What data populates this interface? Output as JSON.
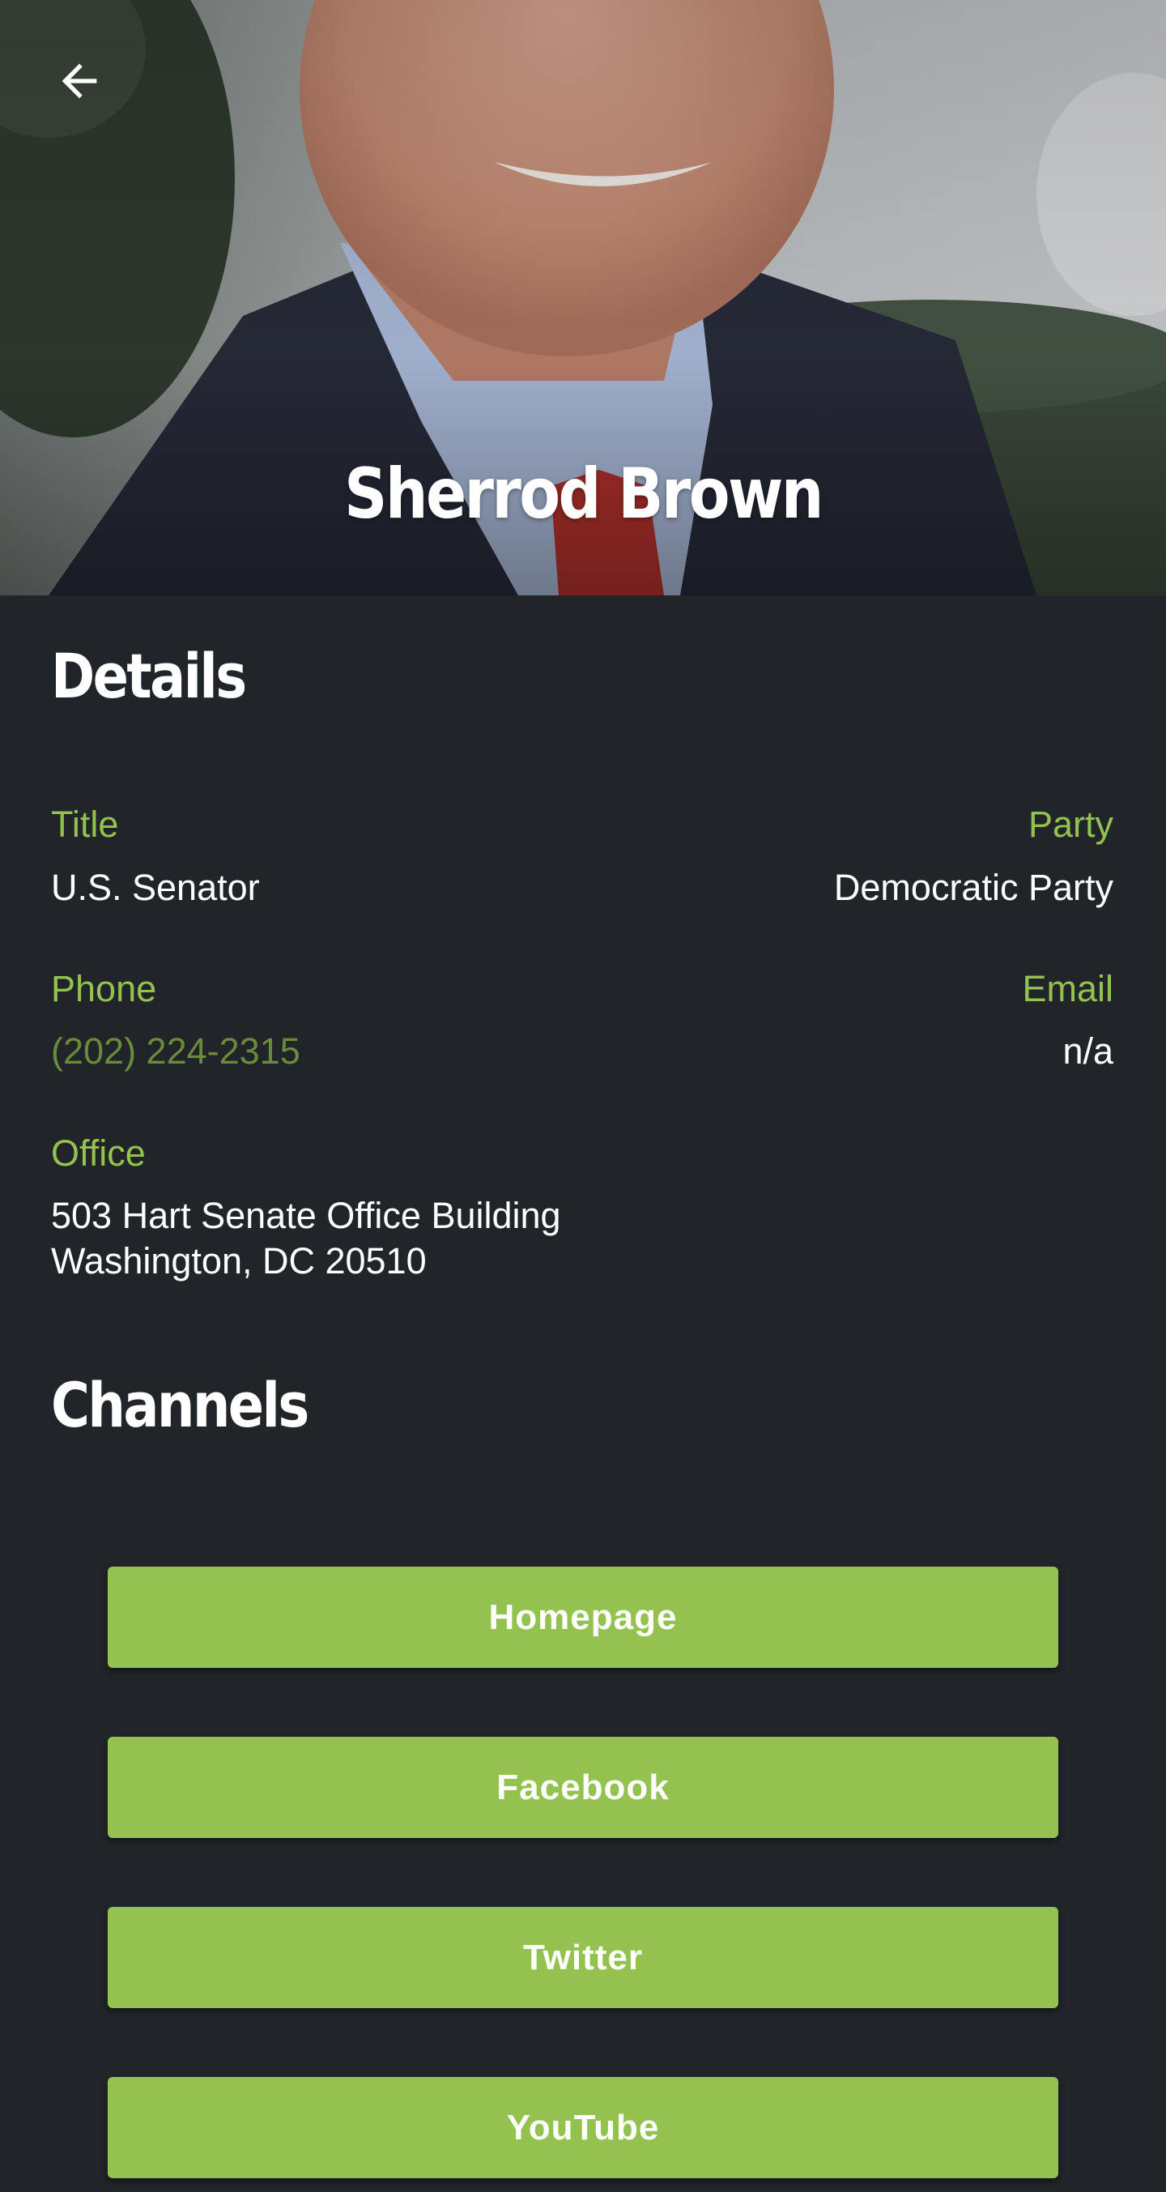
{
  "header": {
    "name": "Sherrod Brown",
    "back_icon": "arrow-left-icon"
  },
  "details": {
    "heading": "Details",
    "title_label": "Title",
    "title_value": "U.S. Senator",
    "party_label": "Party",
    "party_value": "Democratic Party",
    "phone_label": "Phone",
    "phone_value": "(202) 224-2315",
    "email_label": "Email",
    "email_value": "n/a",
    "office_label": "Office",
    "office_line1": "503 Hart Senate Office Building",
    "office_line2": "Washington, DC 20510"
  },
  "channels": {
    "heading": "Channels",
    "buttons": [
      "Homepage",
      "Facebook",
      "Twitter",
      "YouTube"
    ]
  },
  "colors": {
    "background": "#212529",
    "accent": "#94c24f",
    "link": "#6a8b3a",
    "text": "#ffffff"
  }
}
